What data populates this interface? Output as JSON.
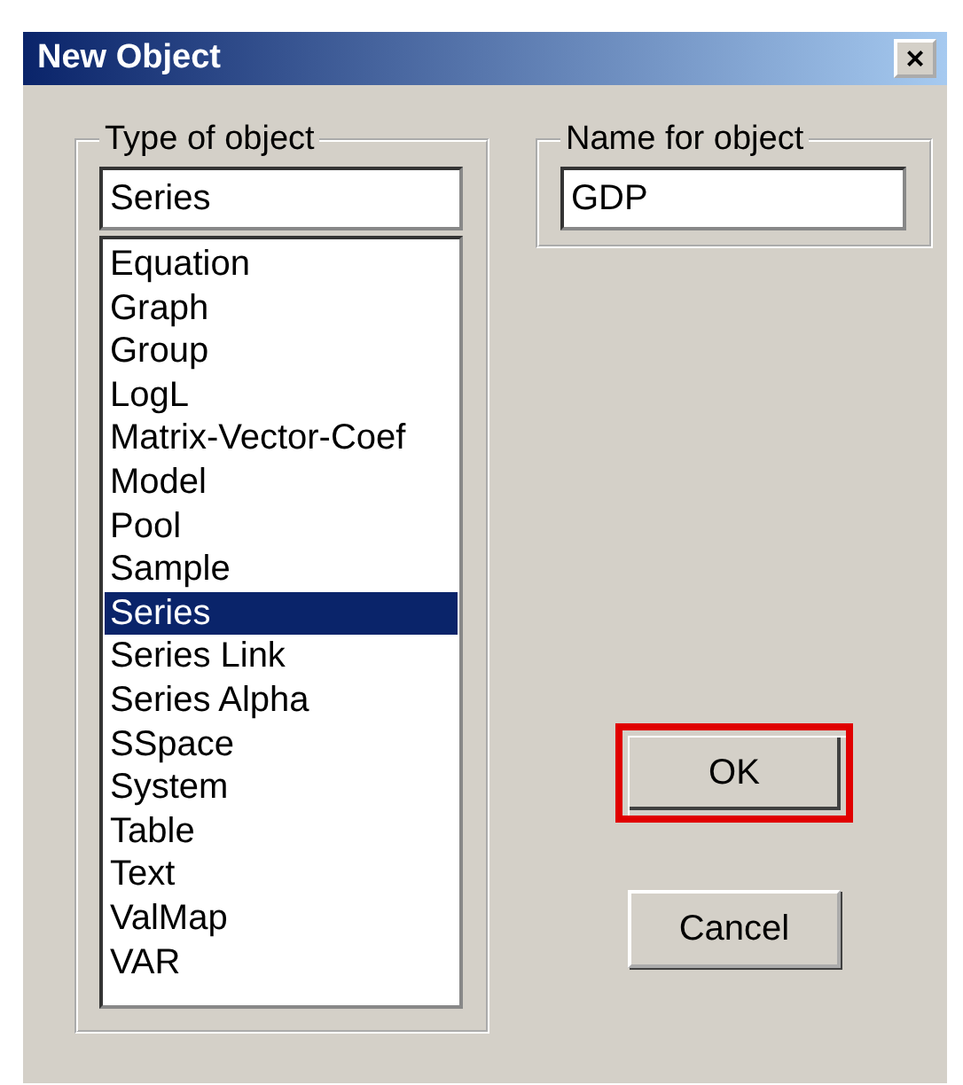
{
  "window": {
    "title": "New Object",
    "close": "×"
  },
  "type_group": {
    "label": "Type of object",
    "value": "Series",
    "items": [
      {
        "label": "Equation",
        "selected": false
      },
      {
        "label": "Graph",
        "selected": false
      },
      {
        "label": "Group",
        "selected": false
      },
      {
        "label": "LogL",
        "selected": false
      },
      {
        "label": "Matrix-Vector-Coef",
        "selected": false
      },
      {
        "label": "Model",
        "selected": false
      },
      {
        "label": "Pool",
        "selected": false
      },
      {
        "label": "Sample",
        "selected": false
      },
      {
        "label": "Series",
        "selected": true
      },
      {
        "label": "Series Link",
        "selected": false
      },
      {
        "label": "Series Alpha",
        "selected": false
      },
      {
        "label": "SSpace",
        "selected": false
      },
      {
        "label": "System",
        "selected": false
      },
      {
        "label": "Table",
        "selected": false
      },
      {
        "label": "Text",
        "selected": false
      },
      {
        "label": "ValMap",
        "selected": false
      },
      {
        "label": "VAR",
        "selected": false
      }
    ]
  },
  "name_group": {
    "label": "Name for object",
    "value": "GDP"
  },
  "buttons": [
    {
      "label": "OK",
      "highlighted": true
    },
    {
      "label": "Cancel",
      "highlighted": false
    }
  ]
}
